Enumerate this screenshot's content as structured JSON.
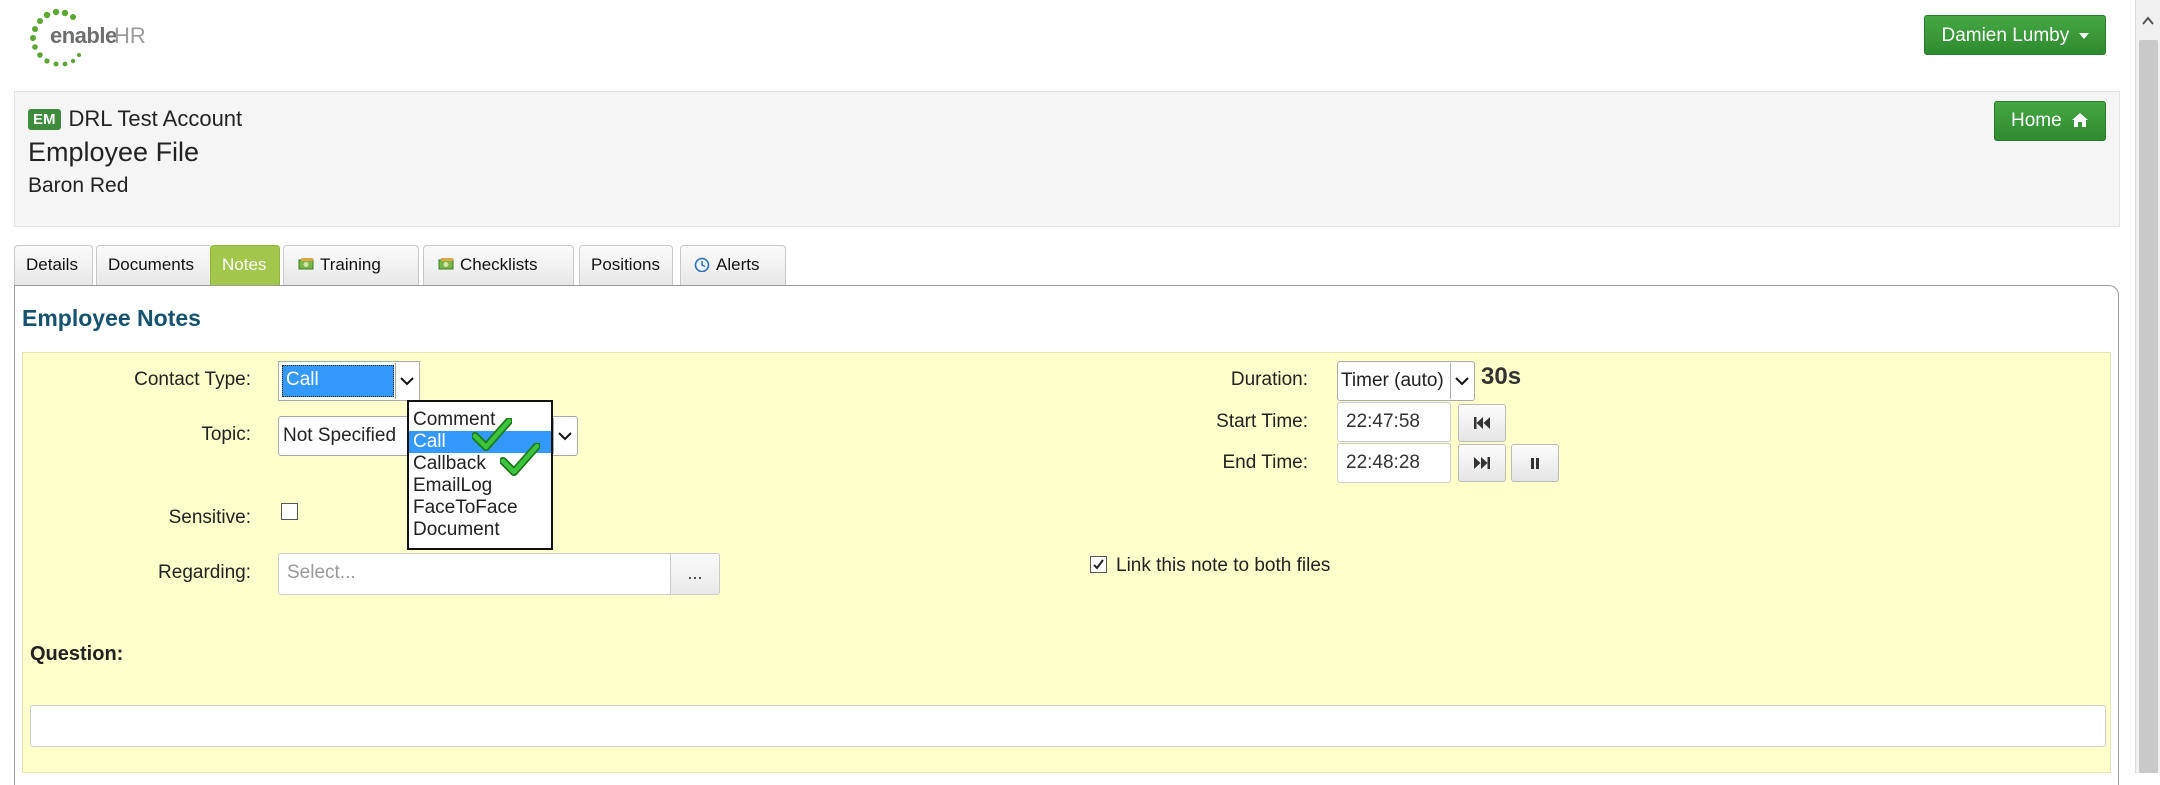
{
  "header": {
    "logo_text_enable": "enable",
    "logo_text_hr": "HR",
    "user_menu_label": "Damien Lumby"
  },
  "account": {
    "badge": "EM",
    "account_name": "DRL Test Account",
    "file_title": "Employee File",
    "employee_name": "Baron Red",
    "home_label": "Home"
  },
  "tabs": [
    {
      "label": "Details",
      "icon": "",
      "active": false
    },
    {
      "label": "Documents",
      "icon": "",
      "active": false
    },
    {
      "label": "Notes",
      "icon": "",
      "active": true
    },
    {
      "label": "Training",
      "icon": "money-icon",
      "active": false
    },
    {
      "label": "Checklists",
      "icon": "money-icon",
      "active": false
    },
    {
      "label": "Positions",
      "icon": "",
      "active": false
    },
    {
      "label": "Alerts",
      "icon": "clock-icon",
      "active": false
    }
  ],
  "notes": {
    "heading": "Employee Notes",
    "contact_type_label": "Contact Type:",
    "contact_type_value": "Call",
    "contact_type_options": [
      "Comment",
      "Call",
      "Callback",
      "EmailLog",
      "FaceToFace",
      "Document"
    ],
    "topic_label": "Topic:",
    "topic_value": "Not Specified",
    "sensitive_label": "Sensitive:",
    "regarding_label": "Regarding:",
    "regarding_placeholder": "Select...",
    "regarding_button": "...",
    "duration_label": "Duration:",
    "duration_mode": "Timer (auto)",
    "duration_value": "30s",
    "start_time_label": "Start Time:",
    "start_time_value": "22:47:58",
    "end_time_label": "End Time:",
    "end_time_value": "22:48:28",
    "link_label": "Link this note to both files",
    "link_checked": true,
    "question_label": "Question:"
  },
  "colors": {
    "brand_green": "#3d9a3d",
    "tab_active": "#a3c64d",
    "heading_blue": "#16536e",
    "form_bg": "#ffffcc",
    "selection_blue": "#3399ff"
  }
}
